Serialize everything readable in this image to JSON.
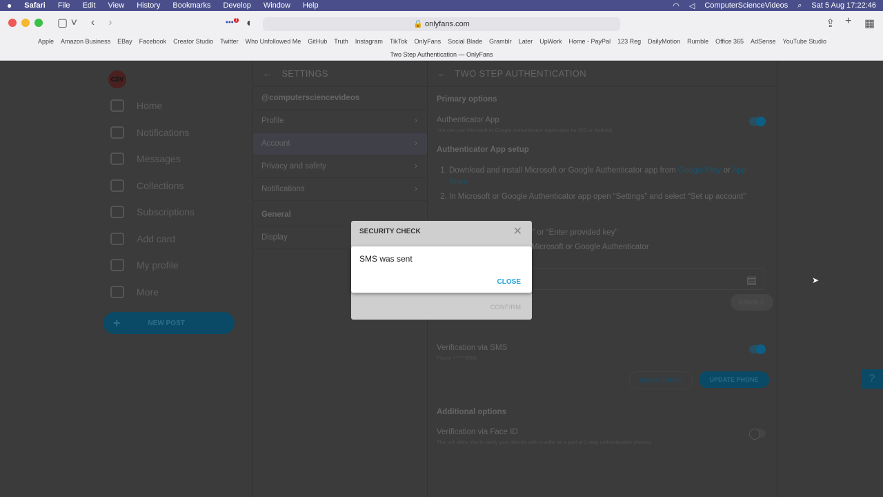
{
  "menubar": {
    "apple": "",
    "app": "Safari",
    "items": [
      "File",
      "Edit",
      "View",
      "History",
      "Bookmarks",
      "Develop",
      "Window",
      "Help"
    ],
    "user": "ComputerScienceVideos",
    "datetime": "Sat 5 Aug  17:22:46"
  },
  "browser": {
    "url": "onlyfans.com",
    "badge": "1",
    "bookmarks": [
      "Apple",
      "Amazon Business",
      "EBay",
      "Facebook",
      "Creator Studio",
      "Twitter",
      "Who Unfollowed Me",
      "GitHub",
      "Truth",
      "Instagram",
      "TikTok",
      "OnlyFans",
      "Social Blade",
      "Gramblr",
      "Later",
      "UpWork",
      "Home - PayPal",
      "123 Reg",
      "DailyMotion",
      "Rumble",
      "Office 365",
      "AdSense",
      "YouTube Studio"
    ],
    "tab_title": "Two Step Authentication — OnlyFans"
  },
  "nav": {
    "logo": "CSV",
    "items": [
      "Home",
      "Notifications",
      "Messages",
      "Collections",
      "Subscriptions",
      "Add card",
      "My profile",
      "More"
    ],
    "new_post": "NEW POST"
  },
  "settings": {
    "title": "SETTINGS",
    "username": "@computersciencevideos",
    "items": [
      "Profile",
      "Account",
      "Privacy and safety",
      "Notifications"
    ],
    "general": "General",
    "display": "Display"
  },
  "main": {
    "title": "TWO STEP AUTHENTICATION",
    "primary": "Primary options",
    "auth_app": "Authenticator App",
    "auth_app_sub": "You can use Microsoft or Google Authenticator application for iOS or Android",
    "auth_app_enabled": true,
    "setup": "Authenticator App setup",
    "step1": "Download and install Microsoft or Google Authenticator app from ",
    "google_play": "Google Play",
    "or": " or",
    "app_store": "App Store",
    "step2": "In Microsoft or Google Authenticator app open “Settings” and select “Set up account”",
    "step3_partial": "e” or “Enter provided key”",
    "step4_partial": "Microsoft or Google Authenticator",
    "enable": "ENABLE",
    "sms": "Verification via SMS",
    "phone": "Phone ******6556",
    "sms_enabled": true,
    "show_codes": "SHOW CODES",
    "update_phone": "UPDATE PHONE",
    "additional": "Additional options",
    "faceid": "Verification via Face ID",
    "faceid_sub": "This will allow you to verify your identity with a selfie as a part of 2 step authentication process",
    "faceid_enabled": false
  },
  "dialog": {
    "title": "SECURITY CHECK",
    "confirm": "CONFIRM",
    "message": "SMS was sent",
    "close": "CLOSE"
  }
}
